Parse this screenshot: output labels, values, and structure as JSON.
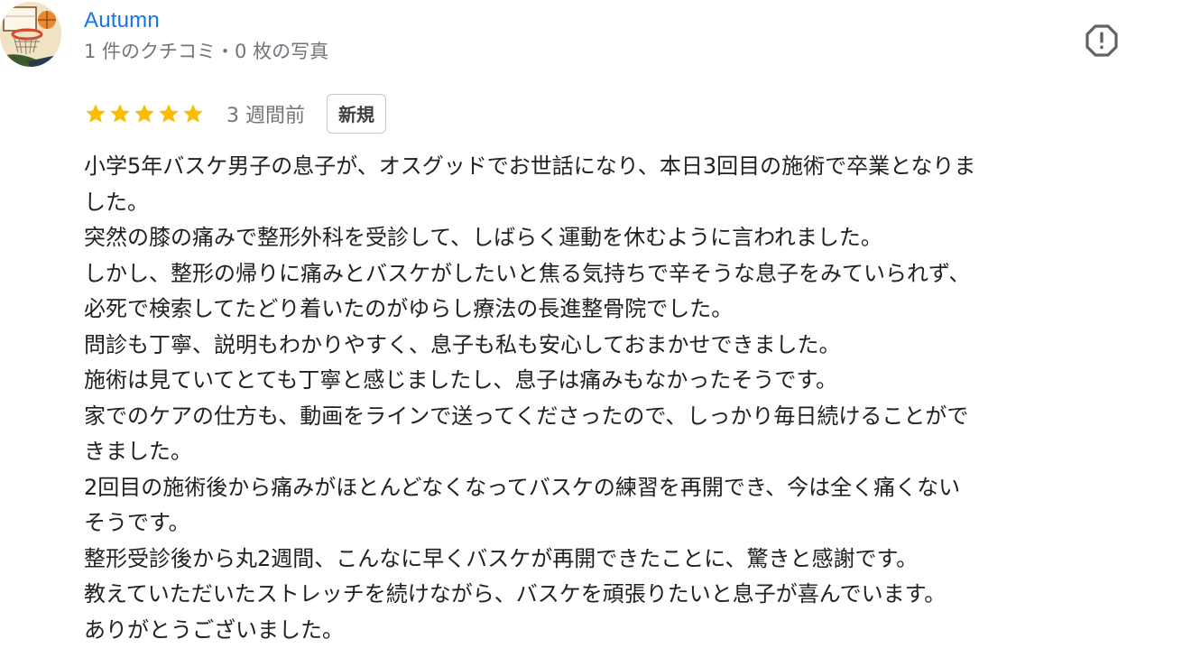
{
  "author": {
    "name": "Autumn",
    "meta": "1 件のクチコミ・0 枚の写真"
  },
  "review": {
    "rating": 5,
    "max_rating": 5,
    "date": "3 週間前",
    "badge": "新規",
    "lines": [
      "小学5年バスケ男子の息子が、オスグッドでお世話になり、本日3回目の施術で卒業となりま",
      "した。",
      "突然の膝の痛みで整形外科を受診して、しばらく運動を休むように言われました。",
      "しかし、整形の帰りに痛みとバスケがしたいと焦る気持ちで辛そうな息子をみていられず、",
      "必死で検索してたどり着いたのがゆらし療法の長進整骨院でした。",
      "問診も丁寧、説明もわかりやすく、息子も私も安心しておまかせできました。",
      "施術は見ていてとても丁寧と感じましたし、息子は痛みもなかったそうです。",
      "家でのケアの仕方も、動画をラインで送ってくださったので、しっかり毎日続けることがで",
      "きました。",
      "2回目の施術後から痛みがほとんどなくなってバスケの練習を再開でき、今は全く痛くない",
      "そうです。",
      "整形受診後から丸2週間、こんなに早くバスケが再開できたことに、驚きと感謝です。",
      "教えていただいたストレッチを続けながら、バスケを頑張りたいと息子が喜んでいます。",
      "ありがとうございました。"
    ]
  },
  "icons": {
    "avatar": "basketball-hoop-illustration",
    "report": "report-octagon-icon",
    "star": "star-icon"
  },
  "colors": {
    "author_name": "#1a73e8",
    "meta_text": "#70757a",
    "star": "#fbbc04",
    "body_text": "#202124",
    "report_icon": "#5f6368"
  }
}
